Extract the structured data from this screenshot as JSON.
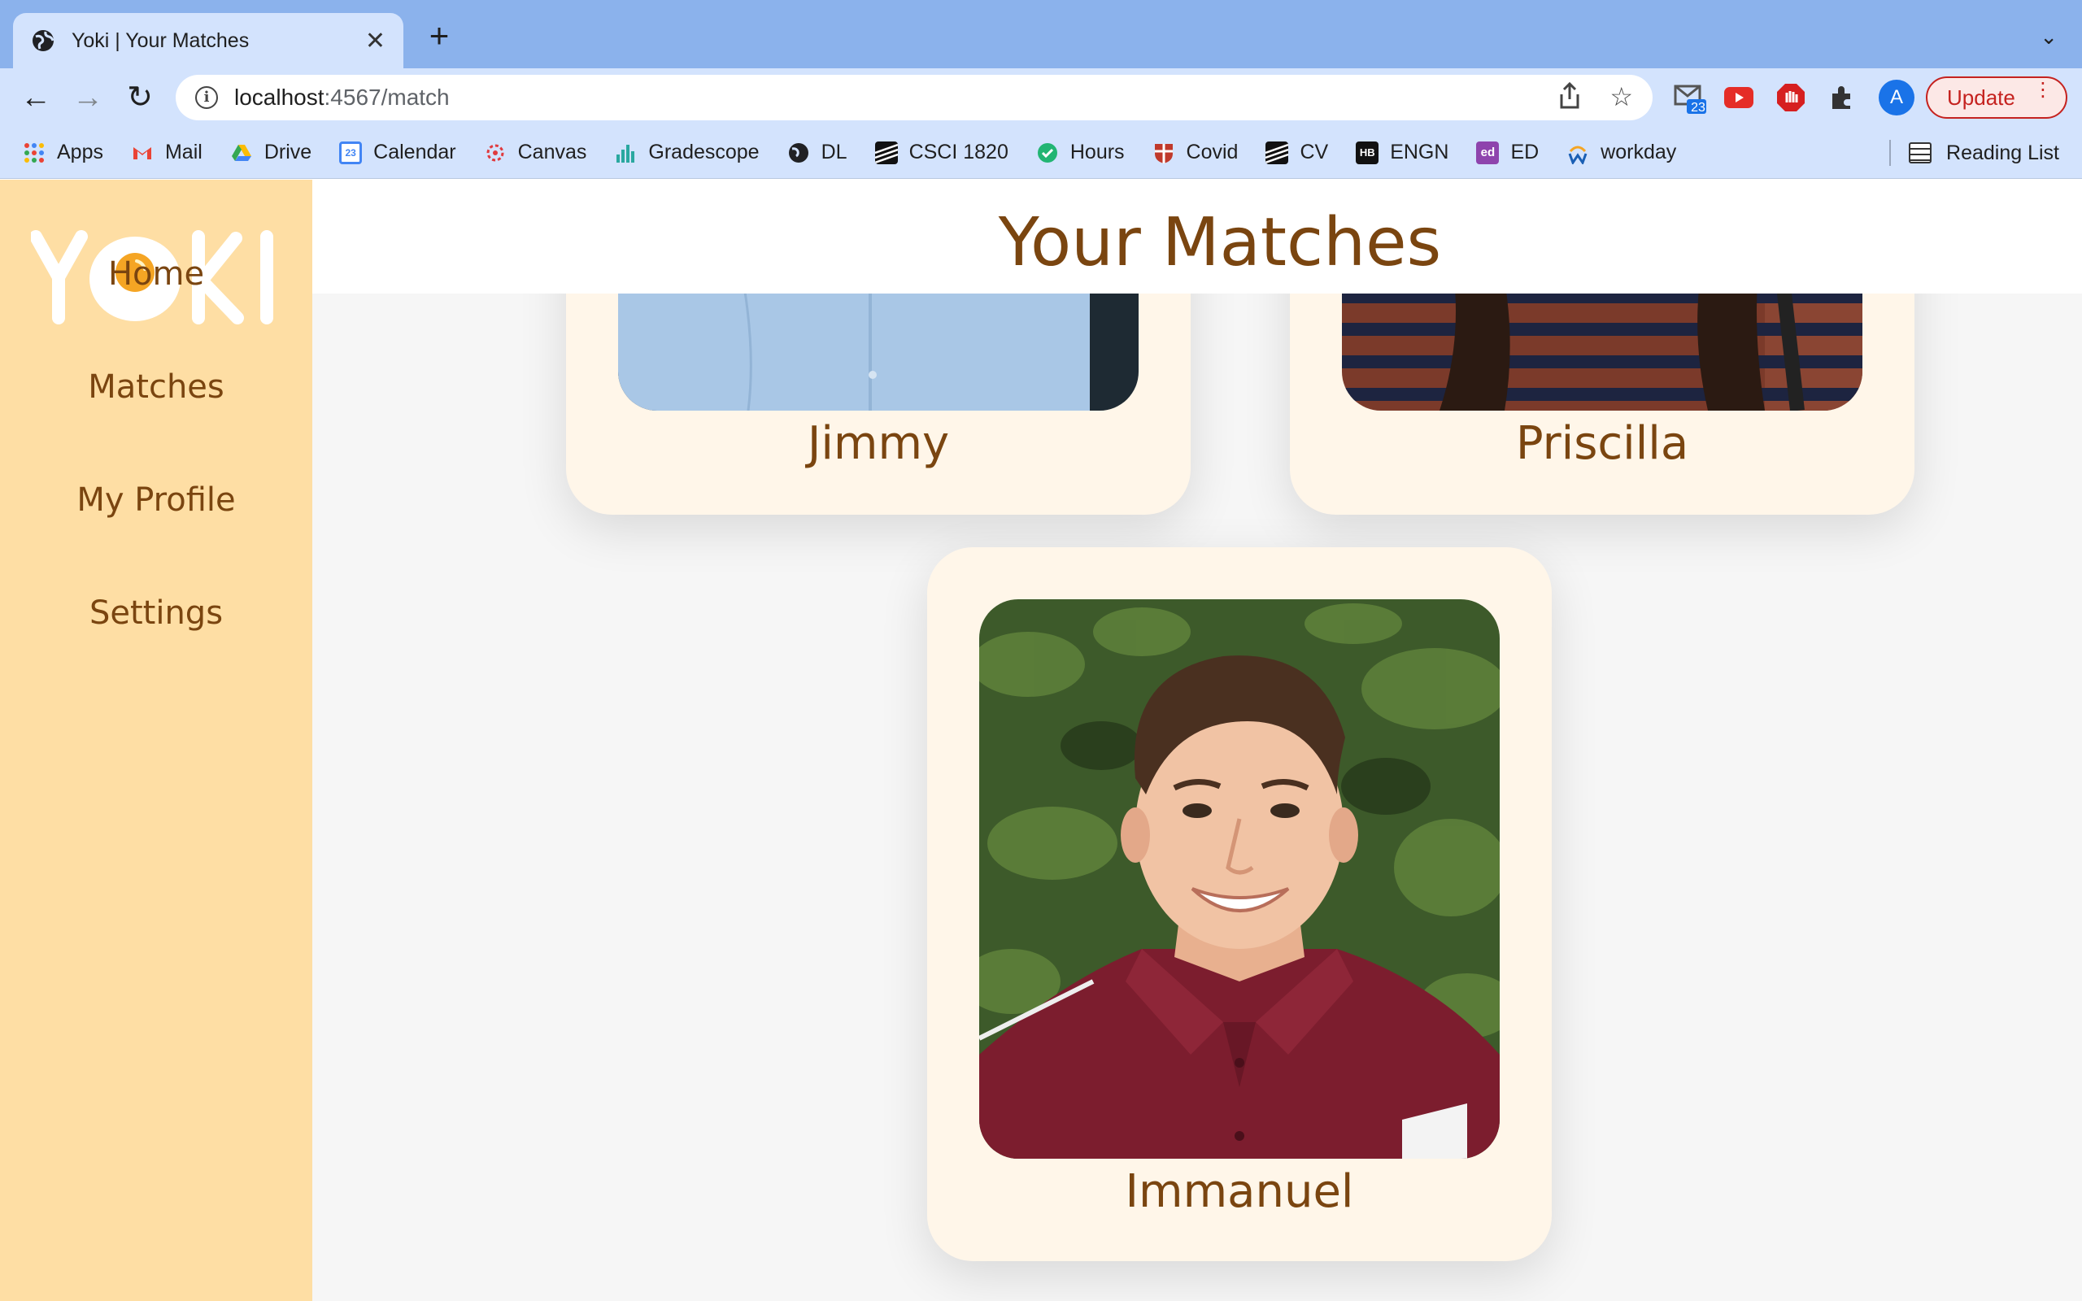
{
  "browser": {
    "tab": {
      "title": "Yoki | Your Matches"
    },
    "address": {
      "host": "localhost",
      "path": ":4567/match"
    },
    "profile_initial": "A",
    "update_label": "Update",
    "mail_badge": "23",
    "bookmarks": [
      {
        "label": "Apps",
        "icon": "apps-grid-icon"
      },
      {
        "label": "Mail",
        "icon": "gmail-icon"
      },
      {
        "label": "Drive",
        "icon": "drive-icon"
      },
      {
        "label": "Calendar",
        "icon": "calendar-icon"
      },
      {
        "label": "Canvas",
        "icon": "canvas-icon"
      },
      {
        "label": "Gradescope",
        "icon": "gradescope-icon"
      },
      {
        "label": "DL",
        "icon": "globe-icon"
      },
      {
        "label": "CSCI 1820",
        "icon": "stripes-icon"
      },
      {
        "label": "Hours",
        "icon": "check-circle-icon"
      },
      {
        "label": "Covid",
        "icon": "shield-crest-icon"
      },
      {
        "label": "CV",
        "icon": "stripes-icon"
      },
      {
        "label": "ENGN",
        "icon": "hb-icon"
      },
      {
        "label": "ED",
        "icon": "ed-icon"
      },
      {
        "label": "workday",
        "icon": "workday-icon"
      }
    ],
    "reading_list": "Reading List"
  },
  "app": {
    "logo_text": "YOKI",
    "nav": [
      {
        "label": "Home"
      },
      {
        "label": "Matches"
      },
      {
        "label": "My Profile"
      },
      {
        "label": "Settings"
      }
    ],
    "page_title": "Your Matches",
    "matches": [
      {
        "name": "Jimmy"
      },
      {
        "name": "Priscilla"
      },
      {
        "name": "Immanuel"
      }
    ]
  },
  "colors": {
    "sidebar_bg": "#fedea4",
    "brand_brown": "#7a4510",
    "card_bg": "#fff6e9",
    "yolk": "#f5a524"
  }
}
